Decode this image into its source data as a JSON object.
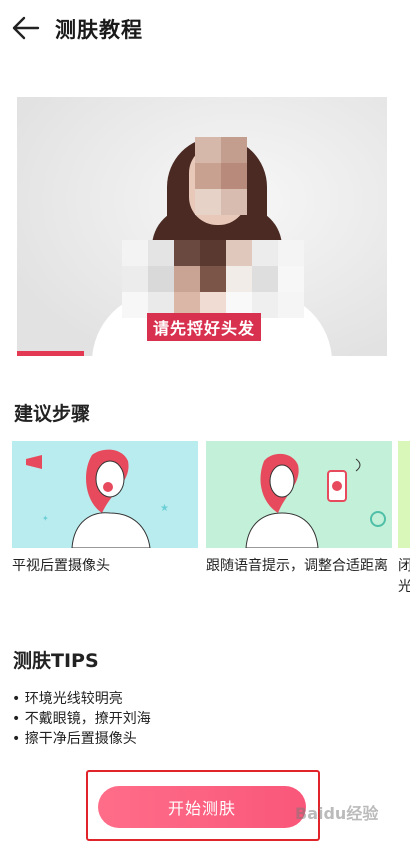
{
  "header": {
    "title": "测肤教程"
  },
  "video": {
    "caption": "请先捋好头发",
    "progress": 0.18
  },
  "steps": {
    "title": "建议步骤",
    "items": [
      {
        "label": "平视后置摄像头"
      },
      {
        "label": "跟随语音提示，调整合适距离"
      },
      {
        "label": "闭光"
      }
    ]
  },
  "tips": {
    "title": "测肤TIPS",
    "items": [
      "• 环境光线较明亮",
      "• 不戴眼镜，撩开刘海",
      "• 擦干净后置摄像头"
    ]
  },
  "actions": {
    "start_label": "开始测肤"
  },
  "watermark": "Baidu经验",
  "colors": {
    "accent": "#e33952",
    "button": "#f9577a",
    "card_bg": "#b9ecef"
  }
}
